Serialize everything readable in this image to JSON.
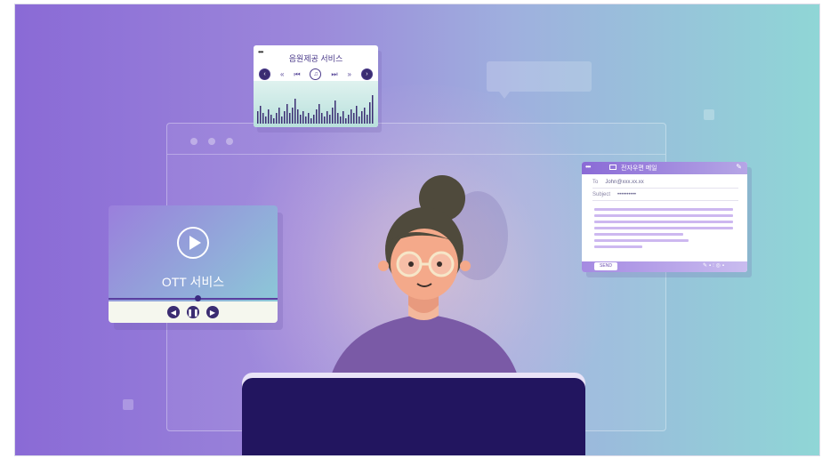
{
  "music_card": {
    "title": "음원제공 서비스",
    "window_dots": "•••",
    "controls": [
      "prev-circle-icon",
      "rewind-icon",
      "skip-back-icon",
      "music-note-icon",
      "skip-forward-icon",
      "fast-forward-icon",
      "next-circle-icon"
    ]
  },
  "ott_card": {
    "label": "OTT 서비스",
    "progress": 0.53,
    "controls": [
      "back-icon",
      "pause-icon",
      "forward-icon"
    ]
  },
  "mail_card": {
    "window_dots": "•••",
    "title": "전자우편 메일",
    "to_label": "To",
    "to_value": "John@xxx.xx.xx",
    "subject_label": "Subject",
    "subject_value": "••••••••••",
    "send_label": "SEND"
  },
  "colors": {
    "background_left": "#8a6ad6",
    "background_right": "#8fd6d6",
    "monitor": "#22155f",
    "accent_dark": "#3b2d72"
  }
}
